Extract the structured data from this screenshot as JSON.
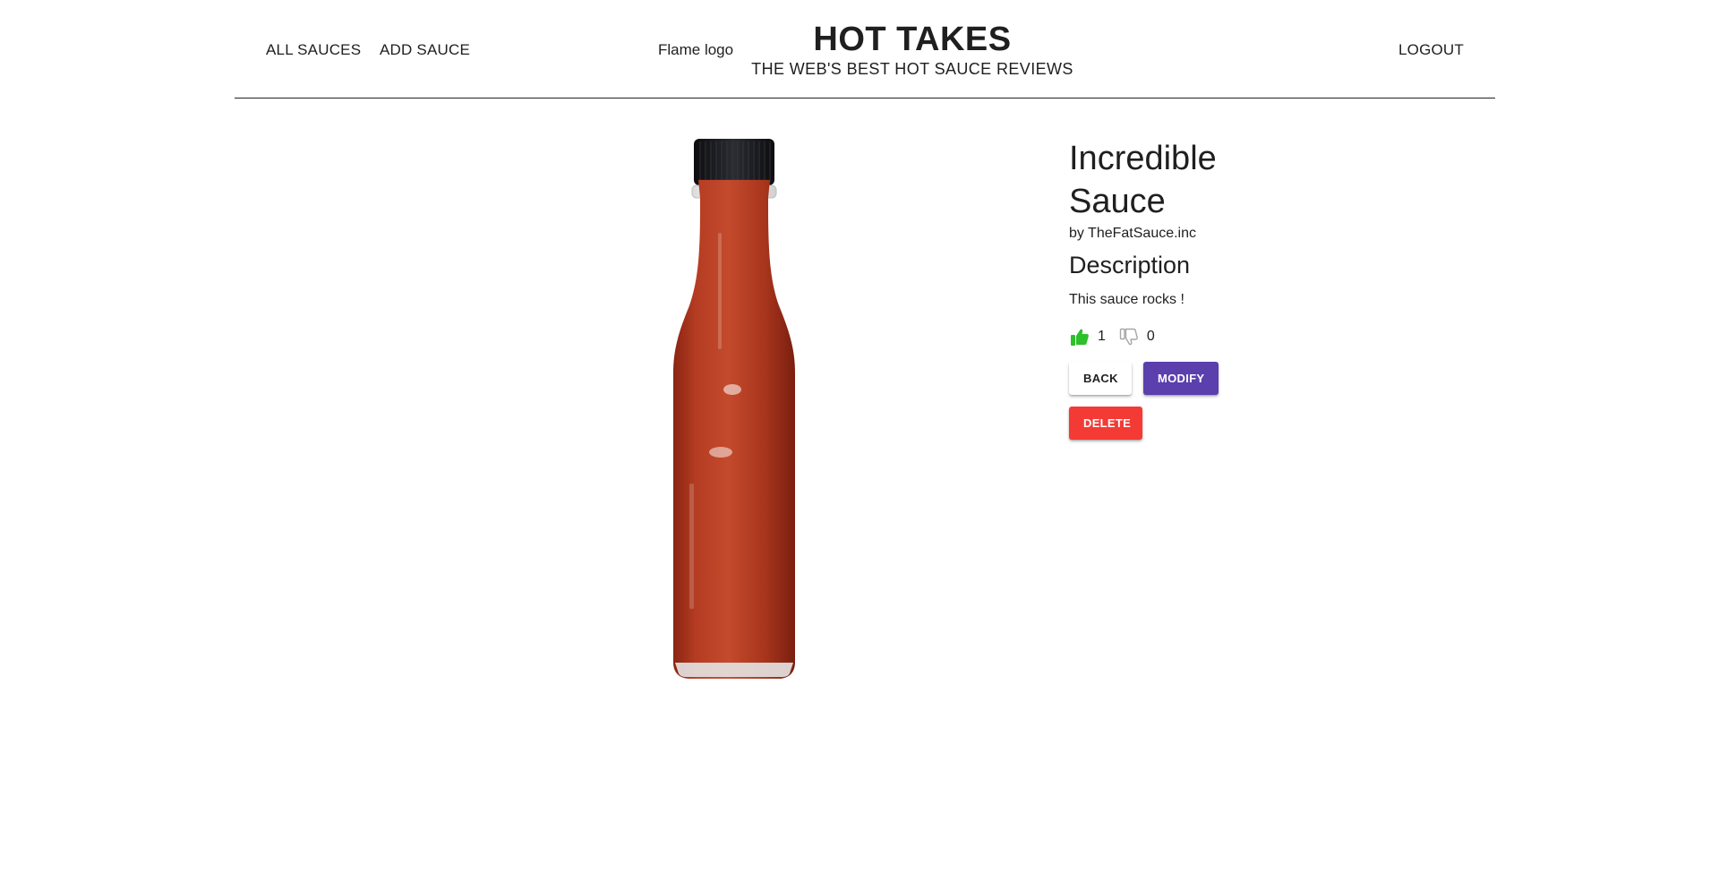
{
  "header": {
    "nav_all_sauces": "ALL SAUCES",
    "nav_add_sauce": "ADD SAUCE",
    "logo_alt": "Flame logo",
    "title": "HOT TAKES",
    "subtitle": "THE WEB'S BEST HOT SAUCE REVIEWS",
    "nav_logout": "LOGOUT"
  },
  "sauce": {
    "name": "Incredible Sauce",
    "manufacturer": "by TheFatSauce.inc",
    "description_heading": "Description",
    "description": "This sauce rocks !",
    "likes": "1",
    "dislikes": "0",
    "image_icon": "hot-sauce-bottle-image"
  },
  "actions": {
    "back": "BACK",
    "modify": "MODIFY",
    "delete": "DELETE"
  },
  "colors": {
    "like_active": "#2cc02a",
    "dislike_inactive": "#a6a6a6",
    "modify_bg": "#5b3fad",
    "delete_bg": "#f43a35",
    "sauce_red": "#b23a22"
  }
}
